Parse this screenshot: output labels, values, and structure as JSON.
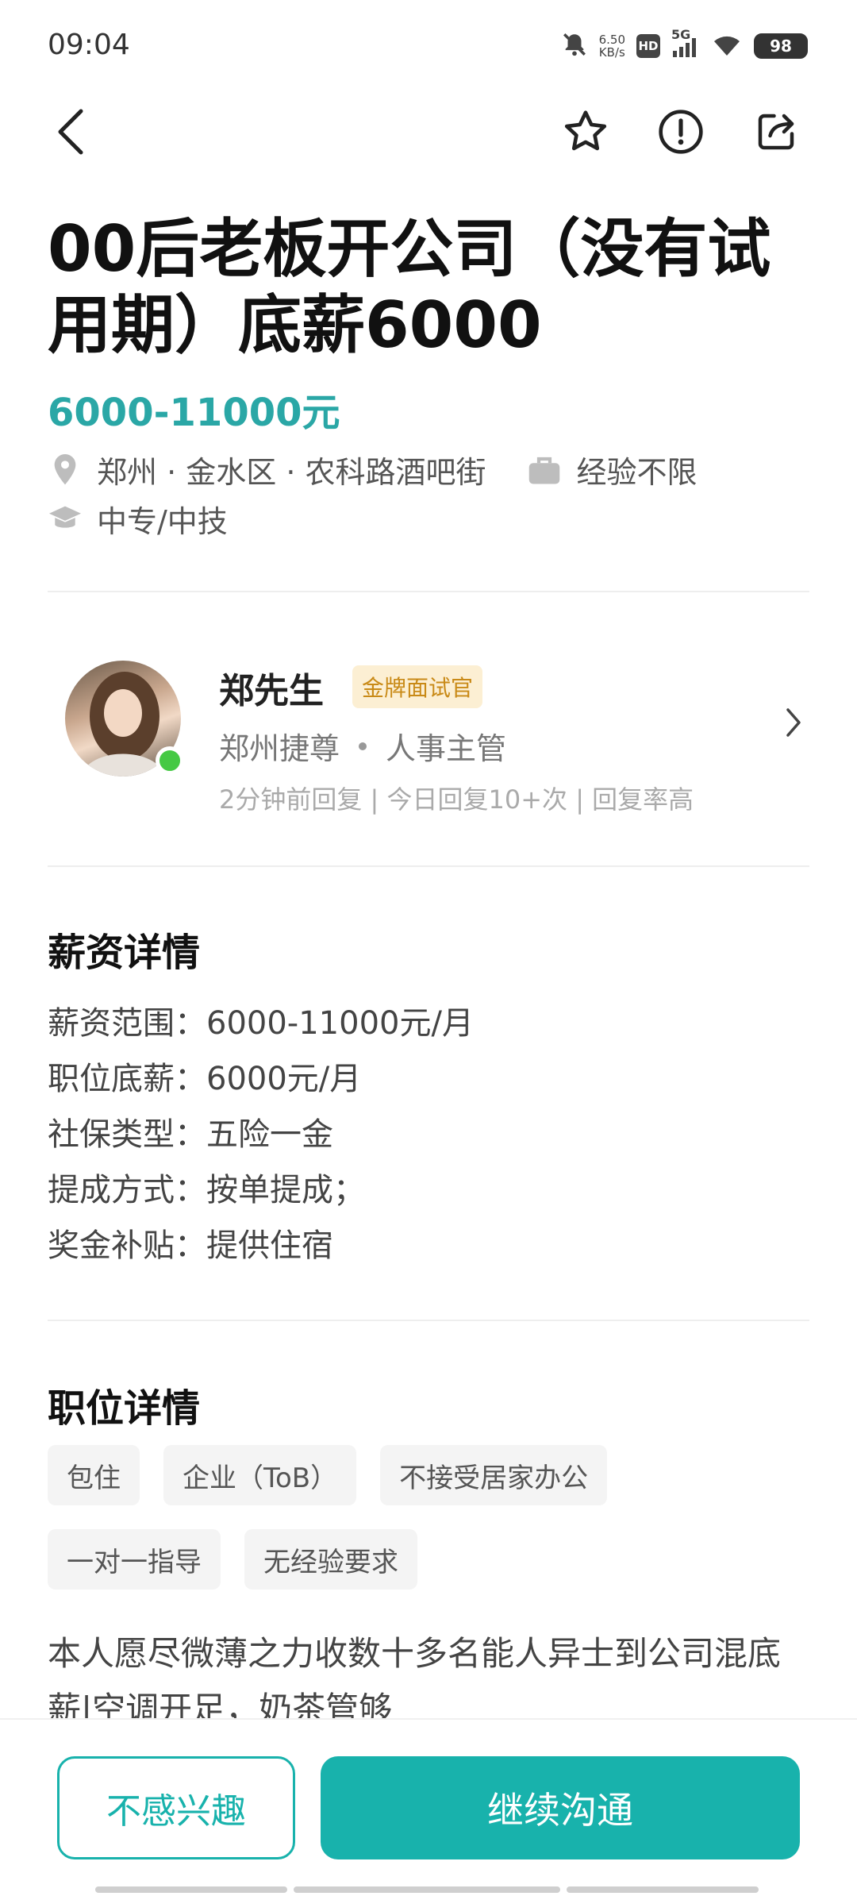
{
  "status_bar": {
    "time": "09:04",
    "speed_value": "6.50",
    "speed_unit": "KB/s",
    "hd": "HD",
    "network": "5G",
    "battery": "98"
  },
  "job": {
    "title": "00后老板开公司（没有试用期）底薪6000",
    "salary": "6000-11000元",
    "location": "郑州 · 金水区 · 农科路酒吧街",
    "experience": "经验不限",
    "education": "中专/中技"
  },
  "recruiter": {
    "name": "郑先生",
    "badge": "金牌面试官",
    "company": "郑州捷尊",
    "position": "人事主管",
    "activity": "2分钟前回复 | 今日回复10+次 | 回复率高"
  },
  "salary_details": {
    "title": "薪资详情",
    "rows": [
      "薪资范围：6000-11000元/月",
      "职位底薪：6000元/月",
      "社保类型：五险一金",
      "提成方式：按单提成；",
      "奖金补贴：提供住宿"
    ]
  },
  "job_details": {
    "title": "职位详情",
    "tags": [
      "包住",
      "企业（ToB）",
      "不接受居家办公",
      "一对一指导",
      "无经验要求"
    ],
    "description": "本人愿尽微薄之力收数十多名能人异士到公司混底薪|空调开足，奶茶管够"
  },
  "actions": {
    "not_interested": "不感兴趣",
    "continue_chat": "继续沟通"
  },
  "colors": {
    "accent": "#18b2ac",
    "salary": "#2aa7a6",
    "badge_bg": "#fcefd3",
    "badge_text": "#c98a17",
    "online": "#45c944"
  }
}
